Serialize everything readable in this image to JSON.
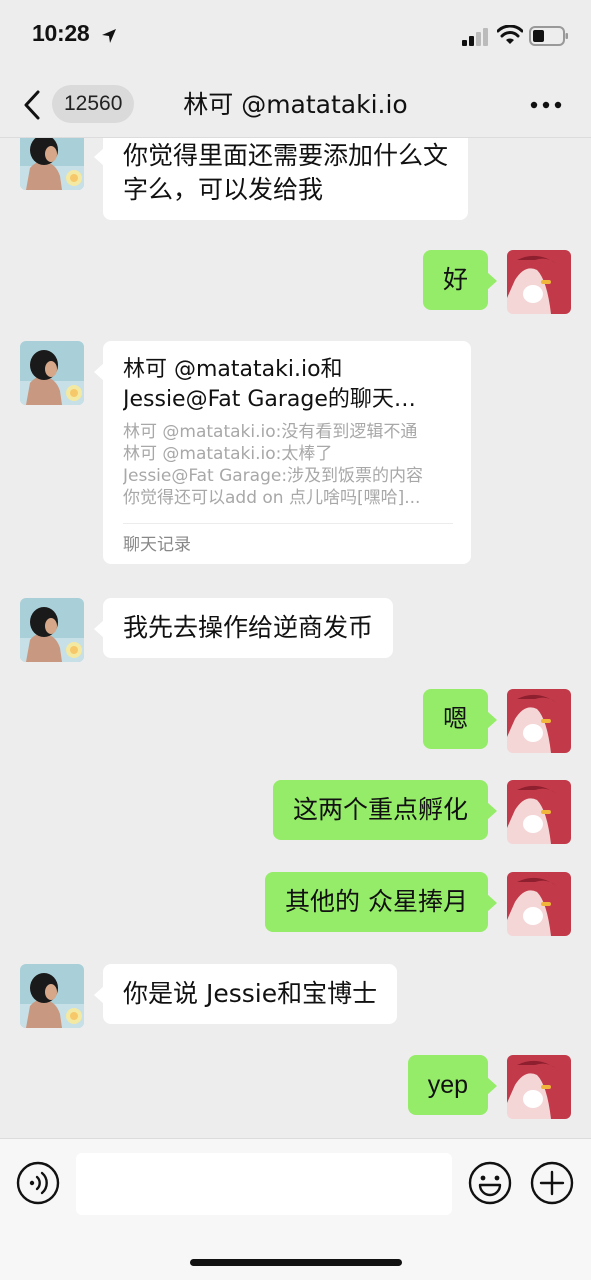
{
  "status_bar": {
    "time": "10:28",
    "icons": [
      "location-arrow-icon",
      "signal-icon",
      "wifi-icon",
      "battery-icon"
    ]
  },
  "nav": {
    "back_icon": "chevron-left-icon",
    "unread_count": "12560",
    "title": "林可 @matataki.io",
    "more_icon": "more-dots-icon"
  },
  "messages": [
    {
      "from": "other",
      "lines": [
        "你觉得里面还需要添加什么文",
        "字么，可以发给我"
      ]
    },
    {
      "from": "self",
      "text": "好"
    },
    {
      "from": "other",
      "type": "chat-record-card",
      "title_lines": [
        "林可 @matataki.io和",
        "Jessie@Fat Garage的聊天…"
      ],
      "preview_lines": [
        "林可 @matataki.io:没有看到逻辑不通",
        "林可 @matataki.io:太棒了",
        "Jessie@Fat Garage:涉及到饭票的内容",
        "你觉得还可以add on 点儿啥吗[嘿哈]..."
      ],
      "footer": "聊天记录"
    },
    {
      "from": "other",
      "text": "我先去操作给逆商发币"
    },
    {
      "from": "self",
      "text": "嗯"
    },
    {
      "from": "self",
      "text": "这两个重点孵化"
    },
    {
      "from": "self",
      "text": "其他的 众星捧月"
    },
    {
      "from": "other",
      "text": "你是说 Jessie和宝博士"
    },
    {
      "from": "self",
      "text": "yep"
    }
  ],
  "input_bar": {
    "voice_icon": "voice-icon",
    "input_value": "",
    "emoji_icon": "emoji-icon",
    "plus_icon": "plus-icon"
  },
  "colors": {
    "background": "#ededed",
    "self_bubble": "#95ec69",
    "other_bubble": "#ffffff"
  }
}
